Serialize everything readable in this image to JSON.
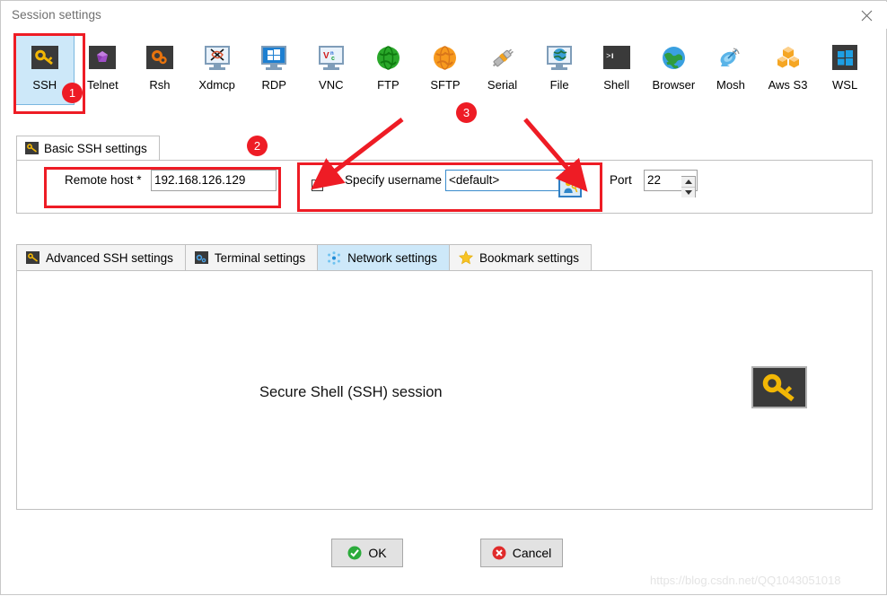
{
  "window": {
    "title": "Session settings",
    "close_icon": "close-icon"
  },
  "toolbar": {
    "protocols": [
      {
        "label": "SSH",
        "icon": "key-icon",
        "selected": true
      },
      {
        "label": "Telnet",
        "icon": "gem-icon",
        "selected": false
      },
      {
        "label": "Rsh",
        "icon": "gears-icon",
        "selected": false
      },
      {
        "label": "Xdmcp",
        "icon": "x-monitor-icon",
        "selected": false
      },
      {
        "label": "RDP",
        "icon": "windows-monitor-icon",
        "selected": false
      },
      {
        "label": "VNC",
        "icon": "vnc-monitor-icon",
        "selected": false
      },
      {
        "label": "FTP",
        "icon": "green-globe-icon",
        "selected": false
      },
      {
        "label": "SFTP",
        "icon": "orange-globe-icon",
        "selected": false
      },
      {
        "label": "Serial",
        "icon": "plug-icon",
        "selected": false
      },
      {
        "label": "File",
        "icon": "blue-globe-monitor-icon",
        "selected": false
      },
      {
        "label": "Shell",
        "icon": "terminal-icon",
        "selected": false
      },
      {
        "label": "Browser",
        "icon": "earth-icon",
        "selected": false
      },
      {
        "label": "Mosh",
        "icon": "satellite-dish-icon",
        "selected": false
      },
      {
        "label": "Aws S3",
        "icon": "aws-cubes-icon",
        "selected": false
      },
      {
        "label": "WSL",
        "icon": "windows-icon",
        "selected": false
      }
    ]
  },
  "basic": {
    "tab_label": "Basic SSH settings",
    "tab_icon": "key-icon",
    "remote_host_label": "Remote host *",
    "remote_host_value": "192.168.126.129",
    "specify_username_label": "Specify username",
    "specify_username_checked": true,
    "username_value": "<default>",
    "username_button_icon": "user-key-icon",
    "port_label": "Port",
    "port_value": "22",
    "port_spinner_up_icon": "chevron-up-icon",
    "port_spinner_down_icon": "chevron-down-icon"
  },
  "lower_tabs": [
    {
      "label": "Advanced SSH settings",
      "icon": "key-icon",
      "active": false
    },
    {
      "label": "Terminal settings",
      "icon": "terminal-blue-icon",
      "active": false
    },
    {
      "label": "Network settings",
      "icon": "network-dots-icon",
      "active": true
    },
    {
      "label": "Bookmark settings",
      "icon": "star-icon",
      "active": false
    }
  ],
  "panel": {
    "session_caption": "Secure Shell (SSH) session",
    "session_icon": "key-icon"
  },
  "footer": {
    "ok_label": "OK",
    "ok_icon": "check-circle-icon",
    "cancel_label": "Cancel",
    "cancel_icon": "x-circle-icon"
  },
  "watermark": {
    "text": "https://blog.csdn.net/QQ1043051018"
  },
  "annotations": {
    "badges": [
      "1",
      "2",
      "3"
    ],
    "accent_color": "#ee1c25"
  }
}
